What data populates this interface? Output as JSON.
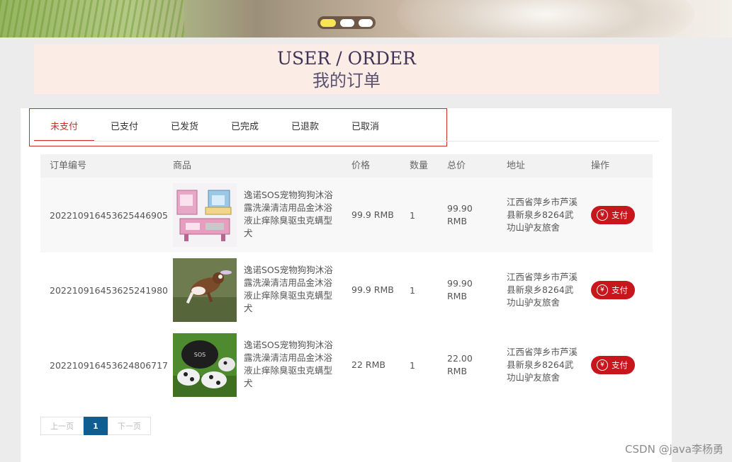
{
  "header": {
    "title_en": "USER / ORDER",
    "title_zh": "我的订单"
  },
  "tabs": [
    {
      "label": "未支付",
      "active": true
    },
    {
      "label": "已支付"
    },
    {
      "label": "已发货"
    },
    {
      "label": "已完成"
    },
    {
      "label": "已退款"
    },
    {
      "label": "已取消"
    }
  ],
  "table": {
    "headers": [
      "订单编号",
      "商品",
      "价格",
      "数量",
      "总价",
      "地址",
      "操作"
    ],
    "rows": [
      {
        "id": "2022109164536254469 05",
        "id_text": "20221091645362544690 5",
        "order_id": "20221091645362544 6905",
        "product": "逸诺SOS宠物狗狗沐浴露洗澡清洁用品金沐浴液止痒除臭驱虫克螨型犬",
        "image": "pet-bath-toy-image",
        "price": "99.9 RMB",
        "qty": "1",
        "total": "99.90 RMB",
        "address": "江西省萍乡市芦溪县新泉乡8264武功山驴友旅舍",
        "action": "支付"
      },
      {
        "product": "逸诺SOS宠物狗狗沐浴露洗澡清洁用品金沐浴液止痒除臭驱虫克螨型犬",
        "image": "jumping-dog-image",
        "price": "99.9 RMB",
        "qty": "1",
        "total": "99.90 RMB",
        "address": "江西省萍乡市芦溪县新泉乡8264武功山驴友旅舍",
        "action": "支付"
      },
      {
        "product": "逸诺SOS宠物狗狗沐浴露洗澡清洁用品金沐浴液止痒除臭驱虫克螨型犬",
        "image": "pet-shoes-image",
        "price": "22 RMB",
        "qty": "1",
        "total": "22.00 RMB",
        "address": "江西省萍乡市芦溪县新泉乡8264武功山驴友旅舍",
        "action": "支付"
      }
    ],
    "order_ids": [
      "20221091645362544 6905",
      "20221091645362524 1980",
      "20221091645362480 6717"
    ]
  },
  "pagination": {
    "prev": "上一页",
    "current": "1",
    "next": "下一页"
  },
  "watermark": "CSDN @java李杨勇",
  "colors": {
    "accent": "#c8161d",
    "tab_active": "#c9302c",
    "page_active": "#0f5e91"
  }
}
